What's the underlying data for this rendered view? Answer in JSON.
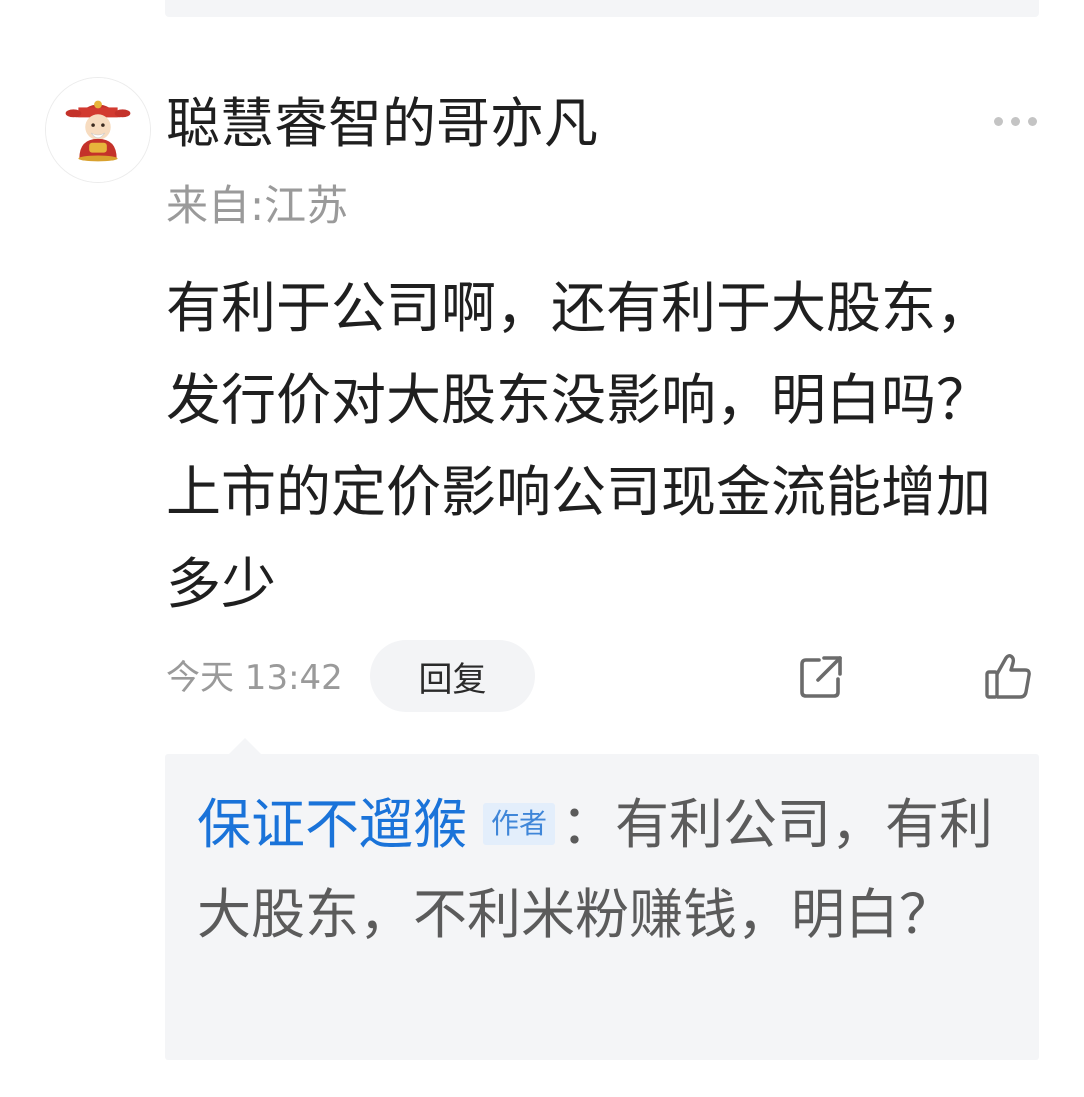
{
  "comment": {
    "username": "聪慧睿智的哥亦凡",
    "location": "来自:江苏",
    "text": "有利于公司啊，还有利于大股东，发行价对大股东没影响，明白吗？上市的定价影响公司现金流能增加多少",
    "timestamp": "今天 13:42",
    "reply_label": "回复",
    "avatar_icon": "cartoon-avatar-icon",
    "more_icon": "more-dots-icon",
    "share_icon": "share-icon",
    "like_icon": "thumbs-up-icon"
  },
  "reply": {
    "author": "保证不遛猴",
    "badge": "作者",
    "separator": "：",
    "text": "有利公司，有利大股东，不利米粉赚钱，明白？"
  },
  "colors": {
    "author_blue": "#1a73d9",
    "badge_bg": "#e3eefb",
    "reply_bg": "#f4f5f7",
    "muted_text": "#9a9a9a"
  }
}
